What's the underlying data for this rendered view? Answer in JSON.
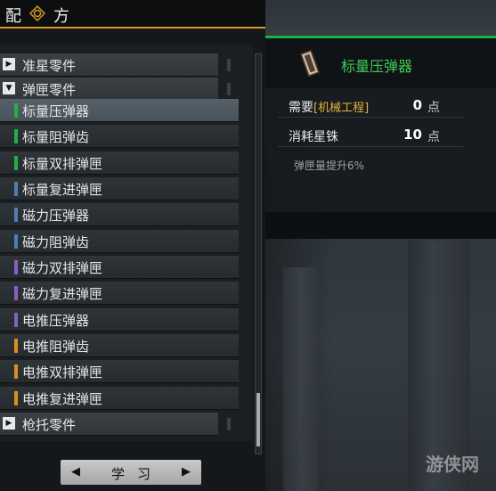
{
  "header": {
    "title_left": "配",
    "title_right": "方",
    "icon": "gear-icon"
  },
  "list": {
    "rows": [
      {
        "type": "category",
        "label": "准星零件",
        "expanded": false
      },
      {
        "type": "category",
        "label": "弹匣零件",
        "expanded": true
      },
      {
        "type": "item",
        "label": "标量压弹器",
        "color": "#21b043",
        "selected": true
      },
      {
        "type": "item",
        "label": "标量阻弹齿",
        "color": "#21b043",
        "selected": false
      },
      {
        "type": "item",
        "label": "标量双排弹匣",
        "color": "#21b043",
        "selected": false
      },
      {
        "type": "item",
        "label": "标量复进弹匣",
        "color": "#4f7fb0",
        "selected": false
      },
      {
        "type": "item",
        "label": "磁力压弹器",
        "color": "#4f7fb0",
        "selected": false
      },
      {
        "type": "item",
        "label": "磁力阻弹齿",
        "color": "#4f7fb0",
        "selected": false
      },
      {
        "type": "item",
        "label": "磁力双排弹匣",
        "color": "#8a5fc0",
        "selected": false
      },
      {
        "type": "item",
        "label": "磁力复进弹匣",
        "color": "#8a5fc0",
        "selected": false
      },
      {
        "type": "item",
        "label": "电推压弹器",
        "color": "#8a5fc0",
        "selected": false
      },
      {
        "type": "item",
        "label": "电推阻弹齿",
        "color": "#d8901e",
        "selected": false
      },
      {
        "type": "item",
        "label": "电推双排弹匣",
        "color": "#d8901e",
        "selected": false
      },
      {
        "type": "item",
        "label": "电推复进弹匣",
        "color": "#d8901e",
        "selected": false
      },
      {
        "type": "category",
        "label": "枪托零件",
        "expanded": false
      }
    ]
  },
  "learn_button": {
    "label": "学习",
    "left_icon": "caret-left-icon",
    "right_icon": "caret-right-icon"
  },
  "detail": {
    "name": "标量压弹器",
    "icon": "magazine-loader-icon",
    "requirement": {
      "label": "需要",
      "tag": "[机械工程]",
      "value": "0",
      "unit": "点"
    },
    "cost": {
      "label": "消耗星铢",
      "value": "10",
      "unit": "点"
    },
    "description": "弹匣量提升6%"
  },
  "watermark": "游侠网",
  "colors": {
    "accent": "#d79b1e",
    "rarity_green": "#21b043",
    "rarity_blue": "#4f7fb0",
    "rarity_purple": "#8a5fc0",
    "rarity_orange": "#d8901e",
    "tag": "#e2b33a"
  }
}
